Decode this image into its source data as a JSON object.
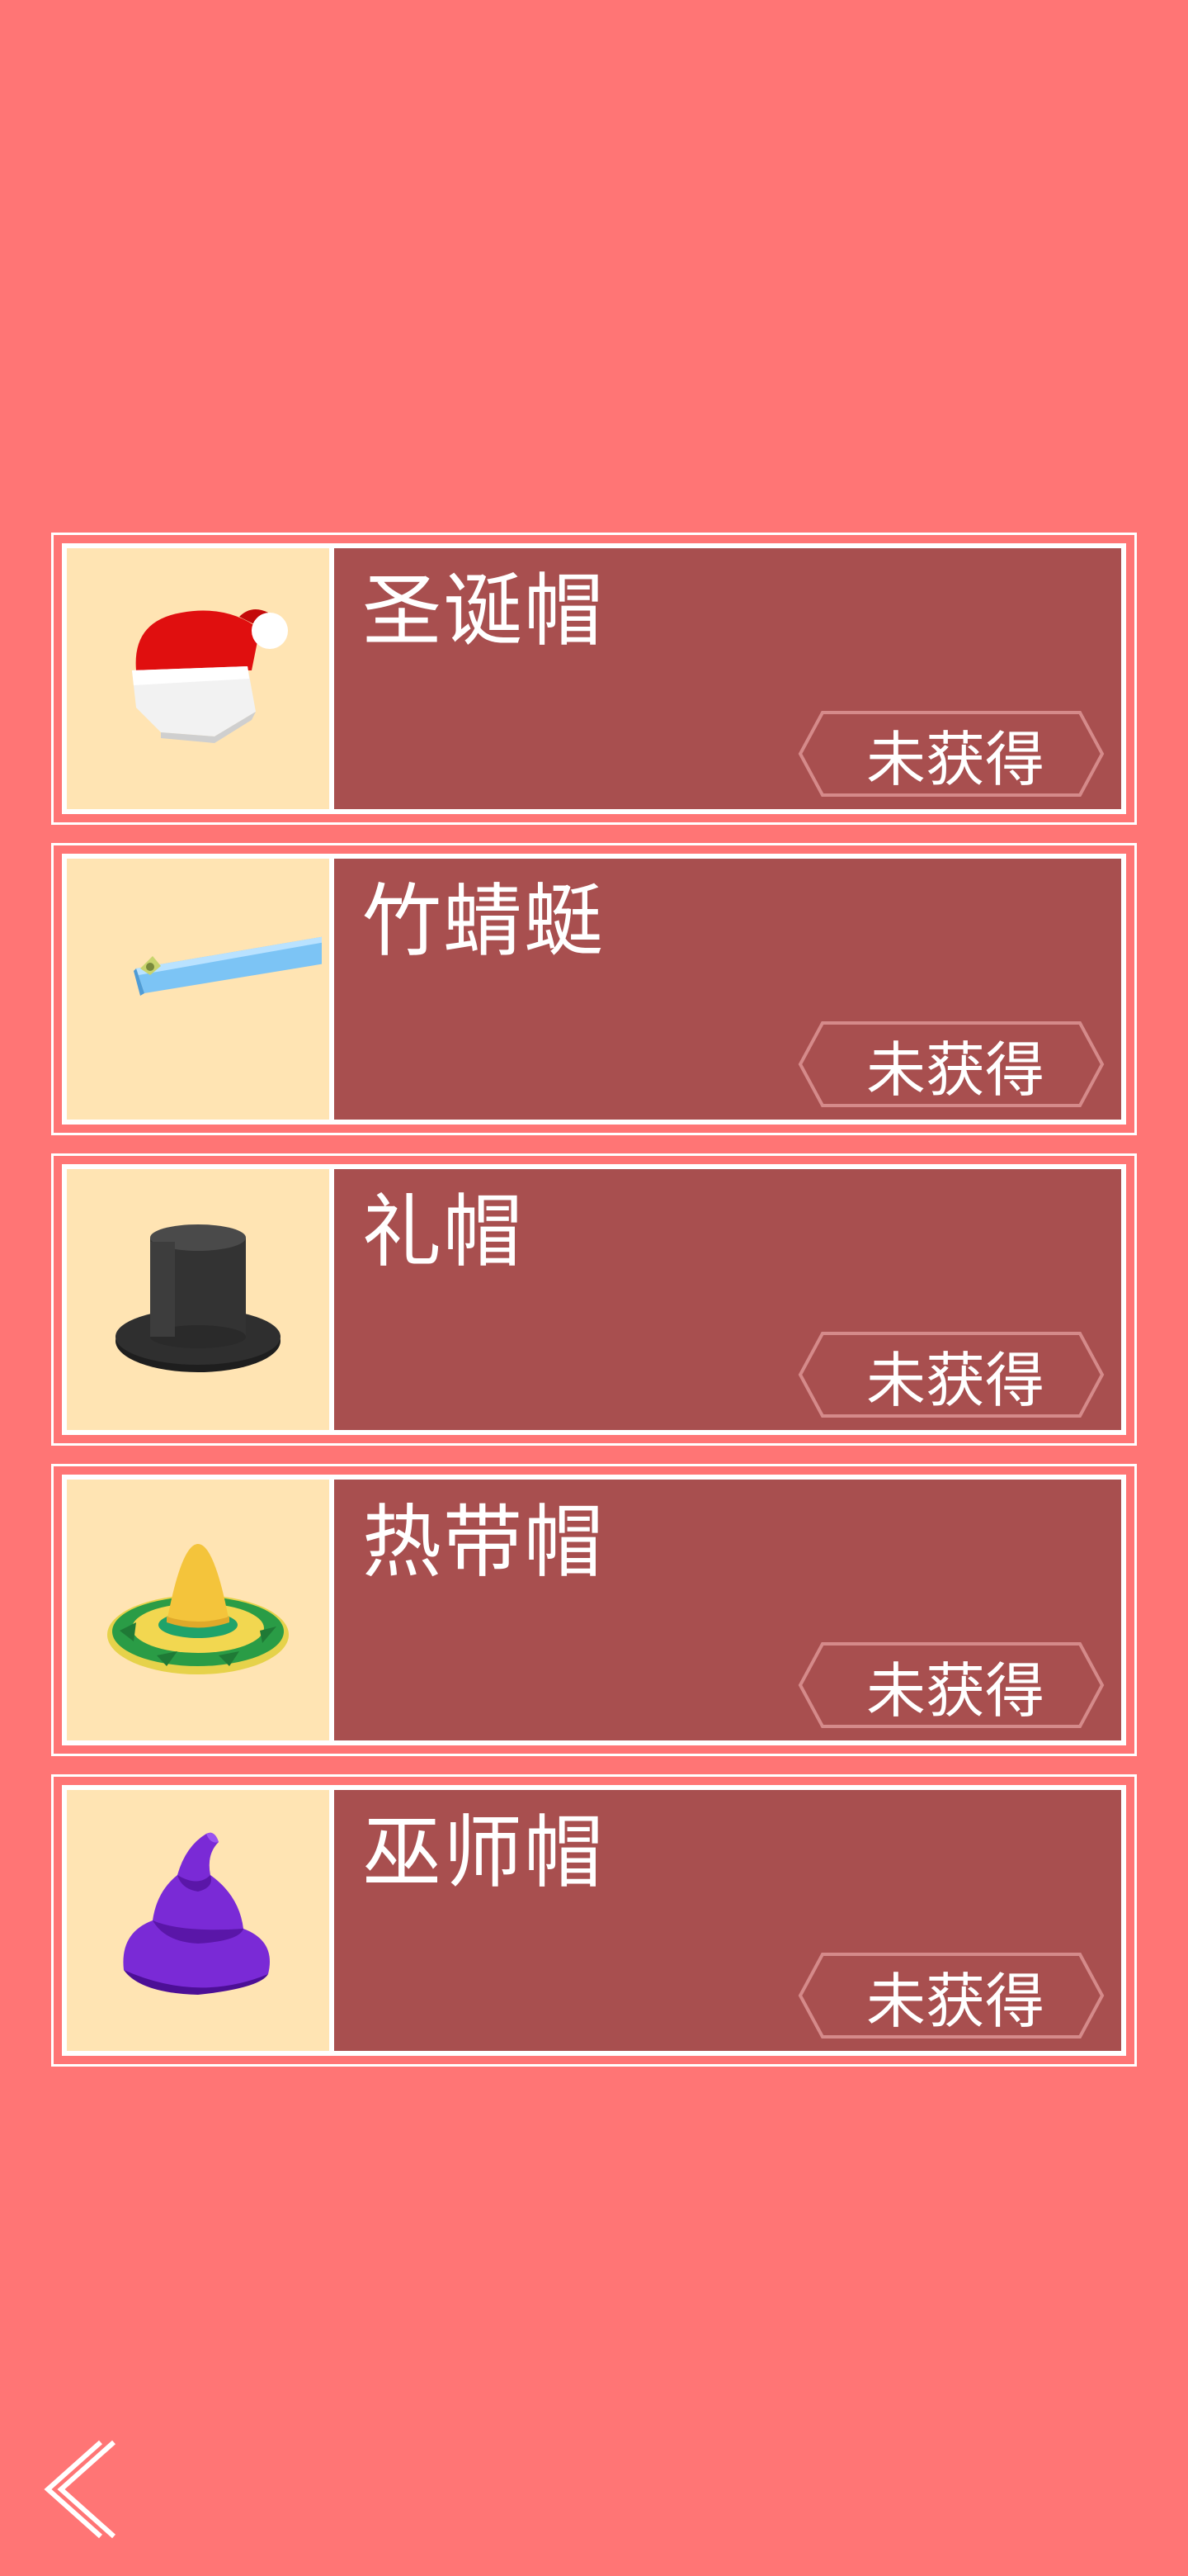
{
  "items": [
    {
      "name": "圣诞帽",
      "status": "未获得",
      "icon": "santa-hat-icon"
    },
    {
      "name": "竹蜻蜓",
      "status": "未获得",
      "icon": "bamboo-copter-icon"
    },
    {
      "name": "礼帽",
      "status": "未获得",
      "icon": "top-hat-icon"
    },
    {
      "name": "热带帽",
      "status": "未获得",
      "icon": "sombrero-icon"
    },
    {
      "name": "巫师帽",
      "status": "未获得",
      "icon": "wizard-hat-icon"
    }
  ],
  "colors": {
    "background": "#ff7575",
    "card": "#a84f4f",
    "thumb": "#ffe4b3",
    "border": "#ffffff"
  },
  "nav": {
    "back_icon": "chevron-left-icon"
  }
}
